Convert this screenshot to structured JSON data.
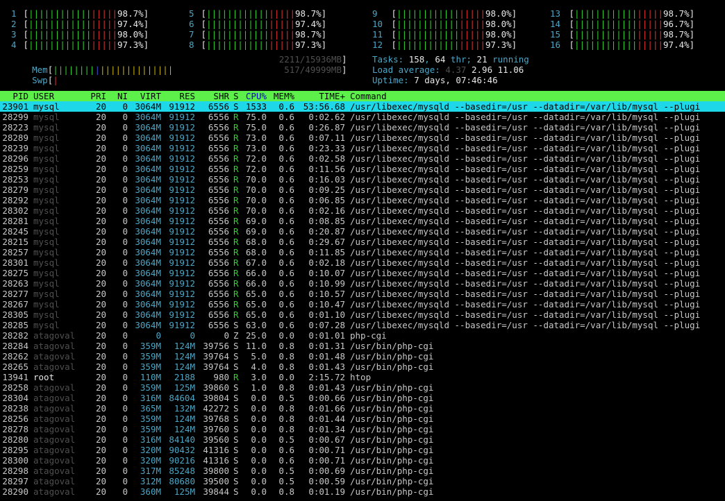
{
  "cpu_meters": [
    {
      "num": "1",
      "bars_green": "||||||||||||",
      "bars_red": "|||||",
      "pct": "98.7%"
    },
    {
      "num": "2",
      "bars_green": "||||||||||||",
      "bars_red": "|||||",
      "pct": "97.4%"
    },
    {
      "num": "3",
      "bars_green": "||||||||||||",
      "bars_red": "|||||",
      "pct": "98.0%"
    },
    {
      "num": "4",
      "bars_green": "||||||||||||",
      "bars_red": "|||||",
      "pct": "97.3%"
    },
    {
      "num": "5",
      "bars_green": "||||||||||||",
      "bars_red": "|||||",
      "pct": "98.7%"
    },
    {
      "num": "6",
      "bars_green": "||||||||||||",
      "bars_red": "|||||",
      "pct": "97.4%"
    },
    {
      "num": "7",
      "bars_green": "||||||||||||",
      "bars_red": "|||||",
      "pct": "98.7%"
    },
    {
      "num": "8",
      "bars_green": "||||||||||||",
      "bars_red": "|||||",
      "pct": "97.3%"
    },
    {
      "num": "9",
      "bars_green": "||||||||||||",
      "bars_red": "|||||",
      "pct": "98.0%"
    },
    {
      "num": "10",
      "bars_green": "||||||||||||",
      "bars_red": "|||||",
      "pct": "98.0%"
    },
    {
      "num": "11",
      "bars_green": "||||||||||||",
      "bars_red": "|||||",
      "pct": "98.0%"
    },
    {
      "num": "12",
      "bars_green": "||||||||||||",
      "bars_red": "|||||",
      "pct": "97.3%"
    },
    {
      "num": "13",
      "bars_green": "||||||||||||",
      "bars_red": "|||||",
      "pct": "98.7%"
    },
    {
      "num": "14",
      "bars_green": "||||||||||||",
      "bars_red": "|||||",
      "pct": "96.7%"
    },
    {
      "num": "15",
      "bars_green": "||||||||||||",
      "bars_red": "|||||",
      "pct": "98.7%"
    },
    {
      "num": "16",
      "bars_green": "||||||||||||",
      "bars_red": "|||||",
      "pct": "97.4%"
    }
  ],
  "mem": {
    "label": "Mem",
    "bars_green": "||||||||",
    "bars_blue": "|",
    "bars_yellow": "||||||||||||||",
    "value": "2211/15936MB"
  },
  "swp": {
    "label": "Swp",
    "bars_red": "|",
    "value": "517/49999MB"
  },
  "tasks": {
    "label": "Tasks: ",
    "count": "158",
    "sep1": ", ",
    "thr": "64",
    "thr_label": " thr; ",
    "running": "21",
    "running_label": " running"
  },
  "load": {
    "label": "Load average: ",
    "l1": "4.37",
    "l5": "2.96",
    "l15": "11.06"
  },
  "uptime": {
    "label": "Uptime: ",
    "value": "7 days, 07:46:46"
  },
  "header": {
    "pid": "PID",
    "user": "USER",
    "pri": "PRI",
    "ni": "NI",
    "virt": "VIRT",
    "res": "RES",
    "shr": "SHR",
    "s": "S",
    "cpu": "CPU%",
    "mem": "MEM%",
    "time": "TIME+",
    "cmd": "Command"
  },
  "processes": [
    {
      "pid": "23901",
      "user": "mysql",
      "pri": "20",
      "ni": "0",
      "virt": "3064M",
      "res": "91912",
      "shr": "6556",
      "s": "S",
      "cpu": "1533",
      "mem": "0.6",
      "time": "53:56.68",
      "cmd": "/usr/libexec/mysqld --basedir=/usr --datadir=/var/lib/mysql --plugi"
    },
    {
      "pid": "28299",
      "user": "mysql",
      "pri": "20",
      "ni": "0",
      "virt": "3064M",
      "res": "91912",
      "shr": "6556",
      "s": "R",
      "cpu": "75.0",
      "mem": "0.6",
      "time": "0:02.62",
      "cmd": "/usr/libexec/mysqld --basedir=/usr --datadir=/var/lib/mysql --plugi"
    },
    {
      "pid": "28223",
      "user": "mysql",
      "pri": "20",
      "ni": "0",
      "virt": "3064M",
      "res": "91912",
      "shr": "6556",
      "s": "R",
      "cpu": "75.0",
      "mem": "0.6",
      "time": "0:26.87",
      "cmd": "/usr/libexec/mysqld --basedir=/usr --datadir=/var/lib/mysql --plugi"
    },
    {
      "pid": "28289",
      "user": "mysql",
      "pri": "20",
      "ni": "0",
      "virt": "3064M",
      "res": "91912",
      "shr": "6556",
      "s": "R",
      "cpu": "73.0",
      "mem": "0.6",
      "time": "0:07.11",
      "cmd": "/usr/libexec/mysqld --basedir=/usr --datadir=/var/lib/mysql --plugi"
    },
    {
      "pid": "28239",
      "user": "mysql",
      "pri": "20",
      "ni": "0",
      "virt": "3064M",
      "res": "91912",
      "shr": "6556",
      "s": "R",
      "cpu": "73.0",
      "mem": "0.6",
      "time": "0:23.33",
      "cmd": "/usr/libexec/mysqld --basedir=/usr --datadir=/var/lib/mysql --plugi"
    },
    {
      "pid": "28296",
      "user": "mysql",
      "pri": "20",
      "ni": "0",
      "virt": "3064M",
      "res": "91912",
      "shr": "6556",
      "s": "R",
      "cpu": "72.0",
      "mem": "0.6",
      "time": "0:02.58",
      "cmd": "/usr/libexec/mysqld --basedir=/usr --datadir=/var/lib/mysql --plugi"
    },
    {
      "pid": "28259",
      "user": "mysql",
      "pri": "20",
      "ni": "0",
      "virt": "3064M",
      "res": "91912",
      "shr": "6556",
      "s": "R",
      "cpu": "72.0",
      "mem": "0.6",
      "time": "0:11.56",
      "cmd": "/usr/libexec/mysqld --basedir=/usr --datadir=/var/lib/mysql --plugi"
    },
    {
      "pid": "28253",
      "user": "mysql",
      "pri": "20",
      "ni": "0",
      "virt": "3064M",
      "res": "91912",
      "shr": "6556",
      "s": "R",
      "cpu": "70.0",
      "mem": "0.6",
      "time": "0:16.03",
      "cmd": "/usr/libexec/mysqld --basedir=/usr --datadir=/var/lib/mysql --plugi"
    },
    {
      "pid": "28279",
      "user": "mysql",
      "pri": "20",
      "ni": "0",
      "virt": "3064M",
      "res": "91912",
      "shr": "6556",
      "s": "R",
      "cpu": "70.0",
      "mem": "0.6",
      "time": "0:09.25",
      "cmd": "/usr/libexec/mysqld --basedir=/usr --datadir=/var/lib/mysql --plugi"
    },
    {
      "pid": "28292",
      "user": "mysql",
      "pri": "20",
      "ni": "0",
      "virt": "3064M",
      "res": "91912",
      "shr": "6556",
      "s": "R",
      "cpu": "70.0",
      "mem": "0.6",
      "time": "0:06.85",
      "cmd": "/usr/libexec/mysqld --basedir=/usr --datadir=/var/lib/mysql --plugi"
    },
    {
      "pid": "28302",
      "user": "mysql",
      "pri": "20",
      "ni": "0",
      "virt": "3064M",
      "res": "91912",
      "shr": "6556",
      "s": "R",
      "cpu": "70.0",
      "mem": "0.6",
      "time": "0:02.16",
      "cmd": "/usr/libexec/mysqld --basedir=/usr --datadir=/var/lib/mysql --plugi"
    },
    {
      "pid": "28281",
      "user": "mysql",
      "pri": "20",
      "ni": "0",
      "virt": "3064M",
      "res": "91912",
      "shr": "6556",
      "s": "R",
      "cpu": "69.0",
      "mem": "0.6",
      "time": "0:08.85",
      "cmd": "/usr/libexec/mysqld --basedir=/usr --datadir=/var/lib/mysql --plugi"
    },
    {
      "pid": "28245",
      "user": "mysql",
      "pri": "20",
      "ni": "0",
      "virt": "3064M",
      "res": "91912",
      "shr": "6556",
      "s": "R",
      "cpu": "69.0",
      "mem": "0.6",
      "time": "0:20.87",
      "cmd": "/usr/libexec/mysqld --basedir=/usr --datadir=/var/lib/mysql --plugi"
    },
    {
      "pid": "28215",
      "user": "mysql",
      "pri": "20",
      "ni": "0",
      "virt": "3064M",
      "res": "91912",
      "shr": "6556",
      "s": "R",
      "cpu": "68.0",
      "mem": "0.6",
      "time": "0:29.67",
      "cmd": "/usr/libexec/mysqld --basedir=/usr --datadir=/var/lib/mysql --plugi"
    },
    {
      "pid": "28257",
      "user": "mysql",
      "pri": "20",
      "ni": "0",
      "virt": "3064M",
      "res": "91912",
      "shr": "6556",
      "s": "R",
      "cpu": "68.0",
      "mem": "0.6",
      "time": "0:11.85",
      "cmd": "/usr/libexec/mysqld --basedir=/usr --datadir=/var/lib/mysql --plugi"
    },
    {
      "pid": "28301",
      "user": "mysql",
      "pri": "20",
      "ni": "0",
      "virt": "3064M",
      "res": "91912",
      "shr": "6556",
      "s": "R",
      "cpu": "67.0",
      "mem": "0.6",
      "time": "0:02.18",
      "cmd": "/usr/libexec/mysqld --basedir=/usr --datadir=/var/lib/mysql --plugi"
    },
    {
      "pid": "28275",
      "user": "mysql",
      "pri": "20",
      "ni": "0",
      "virt": "3064M",
      "res": "91912",
      "shr": "6556",
      "s": "R",
      "cpu": "66.0",
      "mem": "0.6",
      "time": "0:10.07",
      "cmd": "/usr/libexec/mysqld --basedir=/usr --datadir=/var/lib/mysql --plugi"
    },
    {
      "pid": "28263",
      "user": "mysql",
      "pri": "20",
      "ni": "0",
      "virt": "3064M",
      "res": "91912",
      "shr": "6556",
      "s": "R",
      "cpu": "66.0",
      "mem": "0.6",
      "time": "0:10.99",
      "cmd": "/usr/libexec/mysqld --basedir=/usr --datadir=/var/lib/mysql --plugi"
    },
    {
      "pid": "28277",
      "user": "mysql",
      "pri": "20",
      "ni": "0",
      "virt": "3064M",
      "res": "91912",
      "shr": "6556",
      "s": "R",
      "cpu": "65.0",
      "mem": "0.6",
      "time": "0:10.57",
      "cmd": "/usr/libexec/mysqld --basedir=/usr --datadir=/var/lib/mysql --plugi"
    },
    {
      "pid": "28267",
      "user": "mysql",
      "pri": "20",
      "ni": "0",
      "virt": "3064M",
      "res": "91912",
      "shr": "6556",
      "s": "R",
      "cpu": "65.0",
      "mem": "0.6",
      "time": "0:10.47",
      "cmd": "/usr/libexec/mysqld --basedir=/usr --datadir=/var/lib/mysql --plugi"
    },
    {
      "pid": "28305",
      "user": "mysql",
      "pri": "20",
      "ni": "0",
      "virt": "3064M",
      "res": "91912",
      "shr": "6556",
      "s": "R",
      "cpu": "65.0",
      "mem": "0.6",
      "time": "0:01.10",
      "cmd": "/usr/libexec/mysqld --basedir=/usr --datadir=/var/lib/mysql --plugi"
    },
    {
      "pid": "28285",
      "user": "mysql",
      "pri": "20",
      "ni": "0",
      "virt": "3064M",
      "res": "91912",
      "shr": "6556",
      "s": "S",
      "cpu": "63.0",
      "mem": "0.6",
      "time": "0:07.28",
      "cmd": "/usr/libexec/mysqld --basedir=/usr --datadir=/var/lib/mysql --plugi"
    },
    {
      "pid": "28282",
      "user": "atagoval",
      "pri": "20",
      "ni": "0",
      "virt": "0",
      "res": "0",
      "shr": "0",
      "s": "Z",
      "cpu": "25.0",
      "mem": "0.0",
      "time": "0:01.01",
      "cmd": "php-cgi"
    },
    {
      "pid": "28284",
      "user": "atagoval",
      "pri": "20",
      "ni": "0",
      "virt": "359M",
      "res": "124M",
      "shr": "39756",
      "s": "S",
      "cpu": "11.0",
      "mem": "0.8",
      "time": "0:01.31",
      "cmd": "/usr/bin/php-cgi"
    },
    {
      "pid": "28262",
      "user": "atagoval",
      "pri": "20",
      "ni": "0",
      "virt": "359M",
      "res": "124M",
      "shr": "39764",
      "s": "S",
      "cpu": "5.0",
      "mem": "0.8",
      "time": "0:01.48",
      "cmd": "/usr/bin/php-cgi"
    },
    {
      "pid": "28265",
      "user": "atagoval",
      "pri": "20",
      "ni": "0",
      "virt": "359M",
      "res": "124M",
      "shr": "39764",
      "s": "S",
      "cpu": "4.0",
      "mem": "0.8",
      "time": "0:01.43",
      "cmd": "/usr/bin/php-cgi"
    },
    {
      "pid": "13941",
      "user": "root",
      "pri": "20",
      "ni": "0",
      "virt": "110M",
      "res": "2188",
      "shr": "980",
      "s": "R",
      "cpu": "3.0",
      "mem": "0.0",
      "time": "2:15.72",
      "cmd": "htop"
    },
    {
      "pid": "28258",
      "user": "atagoval",
      "pri": "20",
      "ni": "0",
      "virt": "359M",
      "res": "125M",
      "shr": "39860",
      "s": "S",
      "cpu": "1.0",
      "mem": "0.8",
      "time": "0:01.43",
      "cmd": "/usr/bin/php-cgi"
    },
    {
      "pid": "28304",
      "user": "atagoval",
      "pri": "20",
      "ni": "0",
      "virt": "316M",
      "res": "84604",
      "shr": "39804",
      "s": "S",
      "cpu": "0.0",
      "mem": "0.5",
      "time": "0:00.66",
      "cmd": "/usr/bin/php-cgi"
    },
    {
      "pid": "28238",
      "user": "atagoval",
      "pri": "20",
      "ni": "0",
      "virt": "365M",
      "res": "132M",
      "shr": "42272",
      "s": "S",
      "cpu": "0.0",
      "mem": "0.8",
      "time": "0:01.66",
      "cmd": "/usr/bin/php-cgi"
    },
    {
      "pid": "28256",
      "user": "atagoval",
      "pri": "20",
      "ni": "0",
      "virt": "359M",
      "res": "124M",
      "shr": "39768",
      "s": "S",
      "cpu": "0.0",
      "mem": "0.8",
      "time": "0:01.44",
      "cmd": "/usr/bin/php-cgi"
    },
    {
      "pid": "28278",
      "user": "atagoval",
      "pri": "20",
      "ni": "0",
      "virt": "359M",
      "res": "124M",
      "shr": "39760",
      "s": "S",
      "cpu": "0.0",
      "mem": "0.8",
      "time": "0:01.34",
      "cmd": "/usr/bin/php-cgi"
    },
    {
      "pid": "28280",
      "user": "atagoval",
      "pri": "20",
      "ni": "0",
      "virt": "316M",
      "res": "84140",
      "shr": "39560",
      "s": "S",
      "cpu": "0.0",
      "mem": "0.5",
      "time": "0:00.67",
      "cmd": "/usr/bin/php-cgi"
    },
    {
      "pid": "28295",
      "user": "atagoval",
      "pri": "20",
      "ni": "0",
      "virt": "320M",
      "res": "90432",
      "shr": "41316",
      "s": "S",
      "cpu": "0.0",
      "mem": "0.6",
      "time": "0:00.71",
      "cmd": "/usr/bin/php-cgi"
    },
    {
      "pid": "28300",
      "user": "atagoval",
      "pri": "20",
      "ni": "0",
      "virt": "320M",
      "res": "90216",
      "shr": "41316",
      "s": "S",
      "cpu": "0.0",
      "mem": "0.6",
      "time": "0:00.71",
      "cmd": "/usr/bin/php-cgi"
    },
    {
      "pid": "28298",
      "user": "atagoval",
      "pri": "20",
      "ni": "0",
      "virt": "317M",
      "res": "85248",
      "shr": "39800",
      "s": "S",
      "cpu": "0.0",
      "mem": "0.5",
      "time": "0:00.69",
      "cmd": "/usr/bin/php-cgi"
    },
    {
      "pid": "28297",
      "user": "atagoval",
      "pri": "20",
      "ni": "0",
      "virt": "312M",
      "res": "80680",
      "shr": "39500",
      "s": "S",
      "cpu": "0.0",
      "mem": "0.5",
      "time": "0:00.59",
      "cmd": "/usr/bin/php-cgi"
    },
    {
      "pid": "28290",
      "user": "atagoval",
      "pri": "20",
      "ni": "0",
      "virt": "360M",
      "res": "125M",
      "shr": "39844",
      "s": "S",
      "cpu": "0.0",
      "mem": "0.8",
      "time": "0:01.19",
      "cmd": "/usr/bin/php-cgi"
    }
  ],
  "colors": {
    "header_bg": "#5ef04a",
    "selected_bg": "#1ed7e8",
    "bar_green": "#2fd12f",
    "bar_red": "#e03030",
    "label_cyan": "#4aa7c8"
  }
}
